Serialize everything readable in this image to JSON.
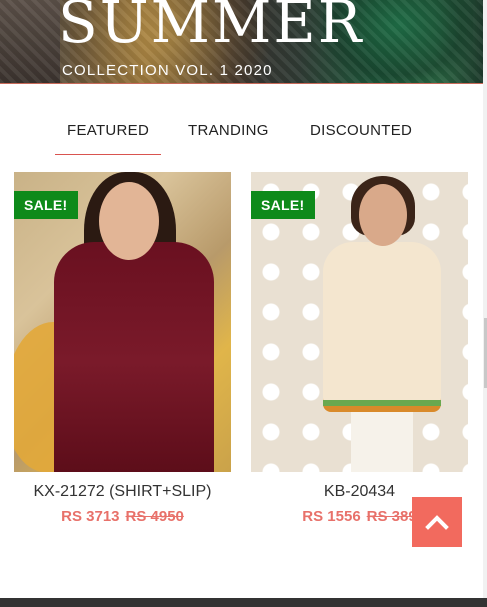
{
  "hero": {
    "headline": "SUMMER",
    "subtitle": "COLLECTION VOL. 1 2020"
  },
  "tabs": [
    {
      "label": "FEATURED",
      "active": true
    },
    {
      "label": "TRANDING",
      "active": false
    },
    {
      "label": "DISCOUNTED",
      "active": false
    }
  ],
  "products": [
    {
      "badge": "SALE!",
      "name": "KX-21272 (SHIRT+SLIP)",
      "price": "RS 3713",
      "old_price": "RS 4950"
    },
    {
      "badge": "SALE!",
      "name": "KB-20434",
      "price": "RS 1556",
      "old_price": "RS 389"
    }
  ],
  "icons": {
    "scroll_top": "chevron-up-icon"
  },
  "colors": {
    "accent": "#f26a5e",
    "sale_badge": "#0e8a1a",
    "price": "#e8716a",
    "footer": "#333333"
  }
}
